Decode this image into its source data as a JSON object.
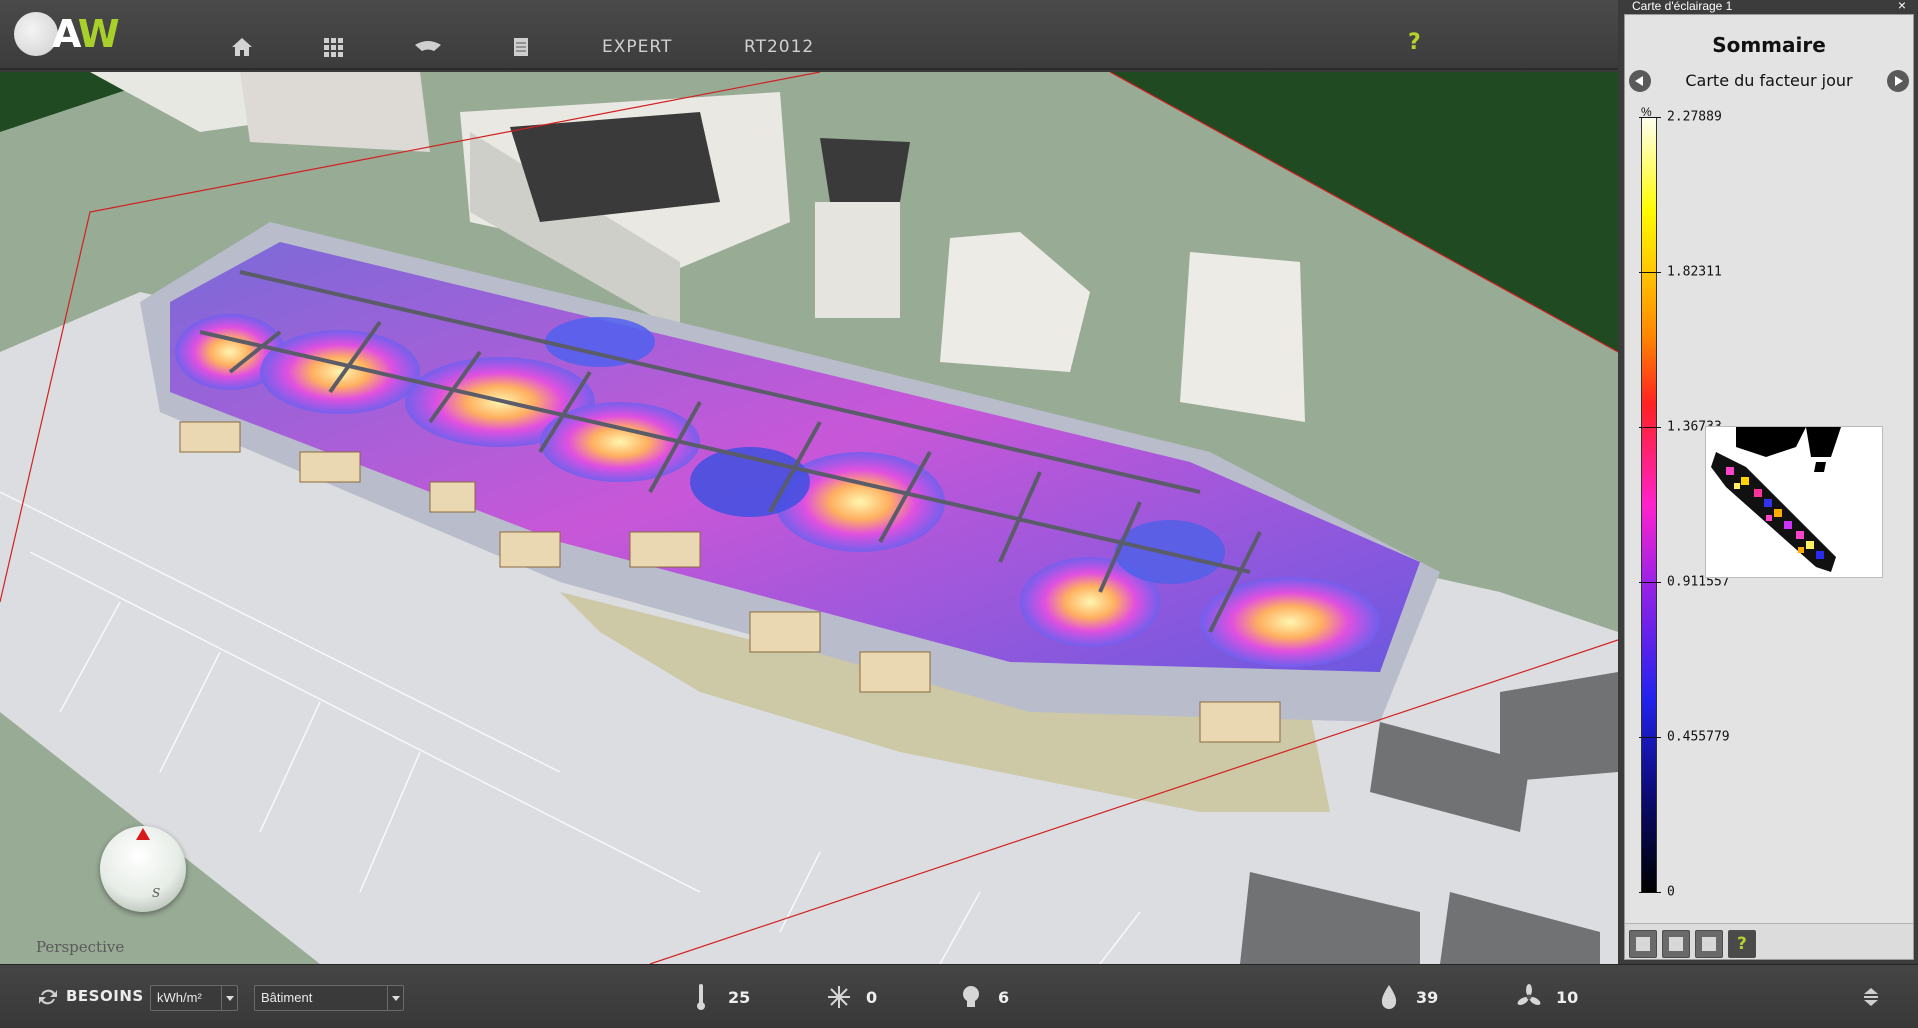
{
  "app": {
    "logo": {
      "letter_a": "A",
      "letter_w": "W"
    }
  },
  "nav": {
    "items": [
      {
        "name": "home-icon"
      },
      {
        "name": "grid-icon"
      },
      {
        "name": "layer-icon"
      },
      {
        "name": "document-icon"
      },
      {
        "label": "EXPERT"
      },
      {
        "label": "RT2012"
      }
    ],
    "help_label": "?"
  },
  "viewport": {
    "view_mode": "Perspective",
    "compass_label": "S"
  },
  "panel": {
    "window_title": "Carte d'éclairage 1",
    "close_label": "×",
    "title": "Sommaire",
    "subtitle": "Carte du facteur jour",
    "scale": {
      "unit": "%",
      "ticks": [
        "2.27889",
        "1.82311",
        "1.36733",
        "0.911557",
        "0.455779",
        "0"
      ]
    },
    "tools": [
      "floor-icon",
      "column-icon",
      "wall-icon"
    ],
    "help_label": "?"
  },
  "statusbar": {
    "mode_label": "BESOINS",
    "unit_select": "kWh/m²",
    "scope_select": "Bâtiment",
    "stats": [
      {
        "icon": "thermometer-icon",
        "value": "25"
      },
      {
        "icon": "sun-icon",
        "value": "0"
      },
      {
        "icon": "lightbulb-icon",
        "value": "6"
      },
      {
        "icon": "water-drop-icon",
        "value": "39"
      },
      {
        "icon": "fan-icon",
        "value": "10"
      }
    ]
  },
  "colors": {
    "accent": "#a8d02a",
    "ground": "#98ab95",
    "grass": "#1f4a22",
    "light_min": "#000000",
    "light_mid": "#ff22cc",
    "light_max": "#fffff0"
  }
}
